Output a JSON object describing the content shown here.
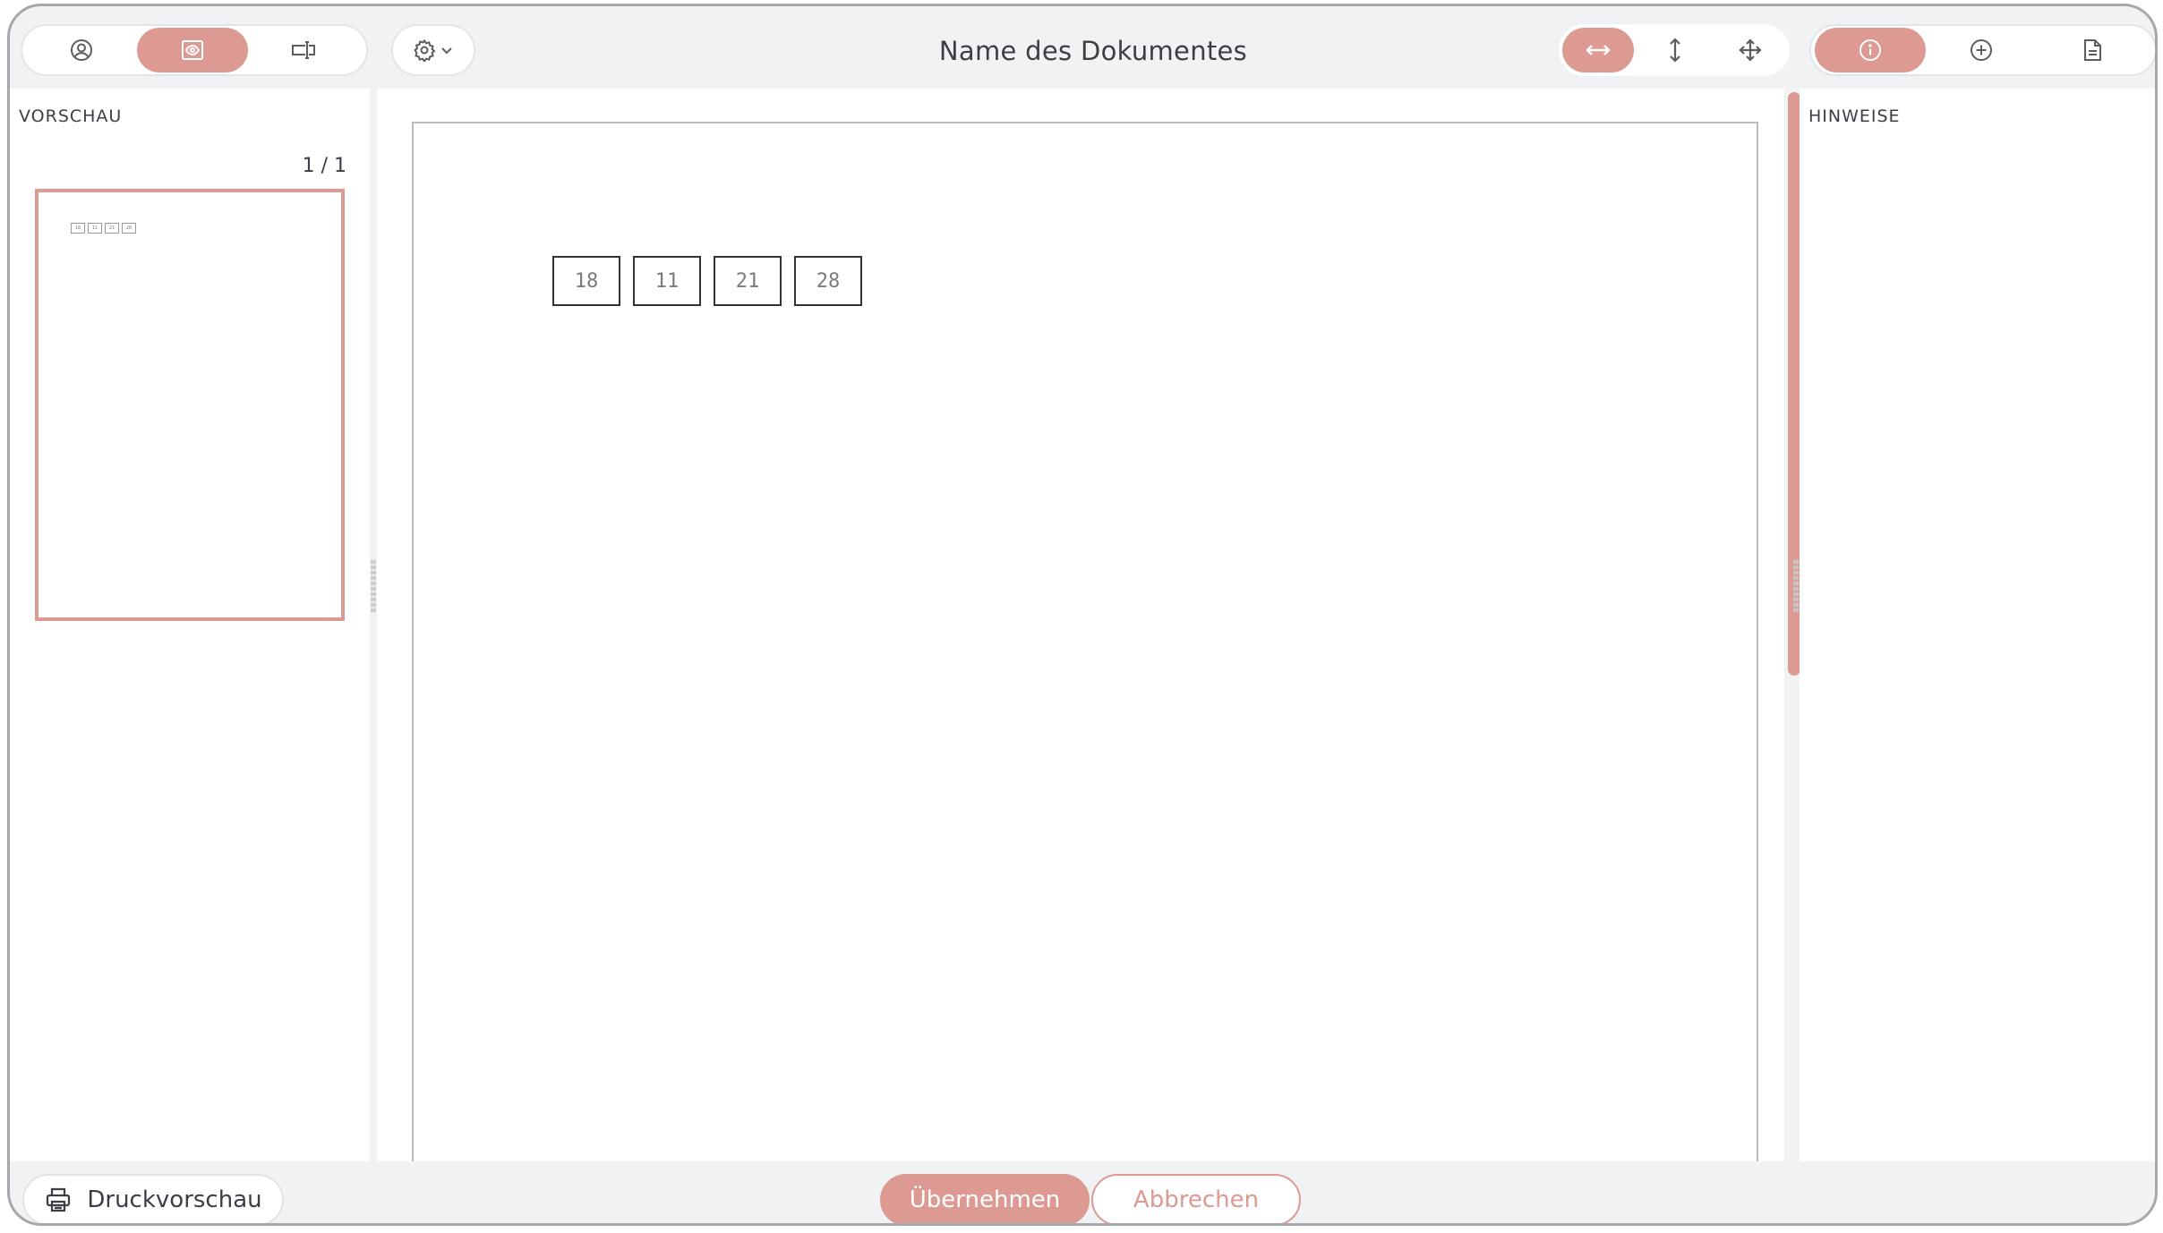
{
  "header": {
    "title": "Name des Dokumentes"
  },
  "left_toolbar": {
    "items": [
      {
        "icon": "user-circle-icon",
        "active": false
      },
      {
        "icon": "preview-eye-icon",
        "active": true
      },
      {
        "icon": "text-field-icon",
        "active": false
      }
    ]
  },
  "settings_menu": {
    "icon": "gear-icon",
    "caret": "chevron-down-icon"
  },
  "view_toolbar": {
    "items": [
      {
        "icon": "fit-width-icon",
        "active": true
      },
      {
        "icon": "fit-height-icon",
        "active": false
      },
      {
        "icon": "move-icon",
        "active": false
      }
    ]
  },
  "right_toolbar": {
    "items": [
      {
        "icon": "info-icon",
        "active": true
      },
      {
        "icon": "add-circle-icon",
        "active": false
      },
      {
        "icon": "document-icon",
        "active": false
      }
    ]
  },
  "left_panel": {
    "label": "VORSCHAU",
    "page_count": "1 / 1"
  },
  "right_panel": {
    "label": "HINWEISE"
  },
  "document": {
    "fields": [
      "18",
      "11",
      "21",
      "28"
    ]
  },
  "footer": {
    "print_label": "Druckvorschau",
    "apply_label": "Übernehmen",
    "cancel_label": "Abbrechen"
  },
  "colors": {
    "accent": "#dc9a93",
    "chrome": "#f1f2f4",
    "text": "#3b3f45"
  }
}
